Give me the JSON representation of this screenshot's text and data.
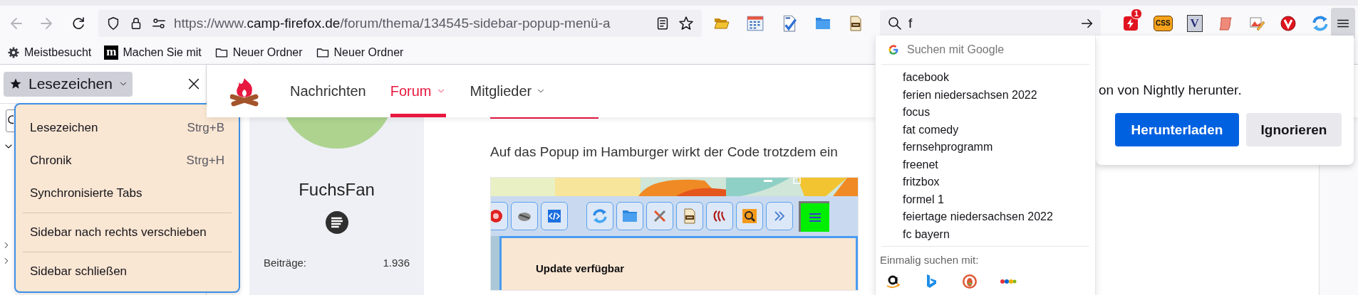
{
  "toolbar": {
    "url": {
      "scheme": "https://www.",
      "domain": "camp-firefox.de",
      "path": "/forum/thema/134545-sidebar-popup-menü-a"
    },
    "search_value": "f",
    "extension_badge": "1",
    "css_icon_text": "CSS",
    "v_icon_text": "V"
  },
  "bookmarks_bar": [
    {
      "kind": "gear",
      "label": "Meistbesucht"
    },
    {
      "kind": "logo",
      "icon_text": "m",
      "label": "Machen Sie mit"
    },
    {
      "kind": "folder",
      "label": "Neuer Ordner"
    },
    {
      "kind": "folder",
      "label": "Neuer Ordner"
    }
  ],
  "sidebar": {
    "title": "Lesezeichen"
  },
  "sidebar_menu": {
    "groups": [
      [
        {
          "label": "Lesezeichen",
          "shortcut": "Strg+B"
        },
        {
          "label": "Chronik",
          "shortcut": "Strg+H"
        },
        {
          "label": "Synchronisierte Tabs"
        }
      ],
      [
        {
          "label": "Sidebar nach rechts verschieben"
        }
      ],
      [
        {
          "label": "Sidebar schließen"
        }
      ]
    ]
  },
  "site_nav": [
    {
      "label": "Nachrichten",
      "selected": false,
      "dropdown": false
    },
    {
      "label": "Forum",
      "selected": true,
      "dropdown": true
    },
    {
      "label": "Mitglieder",
      "selected": false,
      "dropdown": true
    }
  ],
  "profile": {
    "name": "FuchsFan",
    "stat_label": "Beiträge:",
    "stat_value": "1.936"
  },
  "post": {
    "text": "Auf das Popup im Hamburger wirkt der Code trotzdem ein",
    "screenshot": {
      "panel_title": "Update verfügbar"
    }
  },
  "search_popup": {
    "header": "Suchen mit Google",
    "suggestions": [
      "facebook",
      "ferien niedersachsen 2022",
      "focus",
      "fat comedy",
      "fernsehprogramm",
      "freenet",
      "fritzbox",
      "formel 1",
      "feiertage niedersachsen 2022",
      "fc bayern"
    ],
    "one_off_label": "Einmalig suchen mit:"
  },
  "notification": {
    "message": "on von Nightly herunter.",
    "buttons": [
      {
        "label": "Herunterladen",
        "kind": "primary"
      },
      {
        "label": "Ignorieren",
        "kind": "secondary"
      }
    ]
  }
}
